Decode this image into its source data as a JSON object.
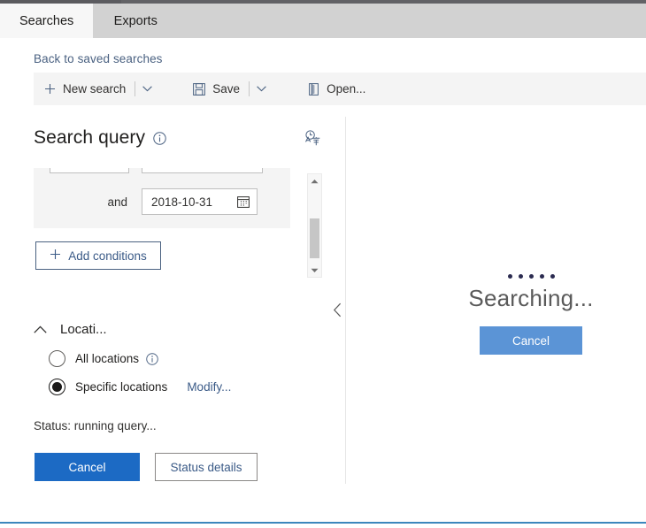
{
  "tabs": [
    {
      "label": "Searches",
      "active": true
    },
    {
      "label": "Exports",
      "active": false
    }
  ],
  "back_link": {
    "label": "Back to saved searches"
  },
  "command_bar": {
    "new_search": {
      "label": "New search",
      "icon": "plus-icon"
    },
    "save": {
      "label": "Save",
      "icon": "save-disk-icon"
    },
    "open": {
      "label": "Open...",
      "icon": "open-door-icon"
    },
    "caret_icon": "chevron-down-icon"
  },
  "search_query": {
    "title": "Search query",
    "info_icon": "info-circle-icon",
    "translate_icon": "translate-icon"
  },
  "conditions": {
    "and_label": "and",
    "date_value": "2018-10-31",
    "calendar_icon": "calendar-icon",
    "add_conditions_label": "Add conditions",
    "add_icon": "plus-icon",
    "scrollbar": {
      "up_icon": "caret-up-icon",
      "down_icon": "caret-down-icon"
    }
  },
  "locations": {
    "section_title": "Locati...",
    "collapse_icon": "chevron-up-icon",
    "options": [
      {
        "label": "All locations",
        "selected": false,
        "info_icon": "info-circle-icon"
      },
      {
        "label": "Specific locations",
        "selected": true
      }
    ],
    "modify_link": "Modify..."
  },
  "status": {
    "text": "Status: running query...",
    "cancel_label": "Cancel",
    "details_label": "Status details"
  },
  "results_pane": {
    "collapse_icon": "chevron-left-icon",
    "searching_label": "Searching...",
    "cancel_label": "Cancel",
    "spinner_dots": 5
  },
  "colors": {
    "accent": "#1c6ac4",
    "accent_light": "#5b94d6",
    "link": "#3a5a87",
    "tab_bar": "#d2d2d2",
    "command_bar": "#f4f4f4",
    "condition_bg": "#f4f4f4",
    "bottom_rule": "#3c87bd"
  }
}
